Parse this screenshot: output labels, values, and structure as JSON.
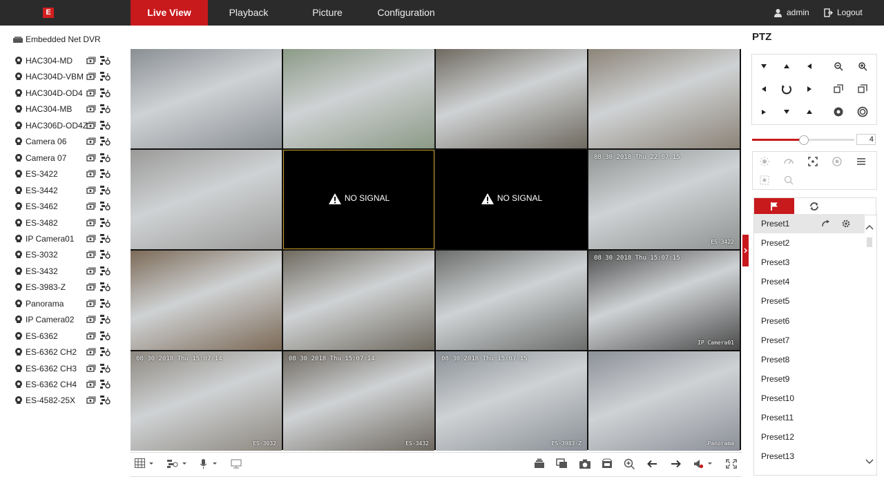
{
  "logo": {
    "text": "E"
  },
  "nav": [
    "Live View",
    "Playback",
    "Picture",
    "Configuration"
  ],
  "user": {
    "name": "admin",
    "logout": "Logout"
  },
  "tree": {
    "root": "Embedded Net DVR",
    "cameras": [
      "HAC304-MD",
      "HAC304D-VBM",
      "HAC304D-OD4",
      "HAC304-MB",
      "HAC306D-OD4Z",
      "Camera 06",
      "Camera 07",
      "ES-3422",
      "ES-3442",
      "ES-3462",
      "ES-3482",
      "IP Camera01",
      "ES-3032",
      "ES-3432",
      "ES-3983-Z",
      "Panorama",
      "IP Camera02",
      "ES-6362",
      "ES-6362 CH2",
      "ES-6362 CH3",
      "ES-6362 CH4",
      "ES-4582-25X"
    ]
  },
  "tiles": [
    {
      "osd": "",
      "name": "",
      "bg": "#8a8f94"
    },
    {
      "osd": "",
      "name": "",
      "bg": "#8b9a86"
    },
    {
      "osd": "",
      "name": "",
      "bg": "#6f6a60"
    },
    {
      "osd": "",
      "name": "",
      "bg": "#8c8478"
    },
    {
      "osd": "",
      "name": "",
      "bg": "#9a9a98"
    },
    {
      "osd": "",
      "name": "",
      "bg": "#000000",
      "nosignal": "NO SIGNAL",
      "selected": true
    },
    {
      "osd": "",
      "name": "",
      "bg": "#000000",
      "nosignal": "NO SIGNAL"
    },
    {
      "osd": "08 30 2018 Thu 22:07:15",
      "name": "ES-3422",
      "bg": "#8f9392"
    },
    {
      "osd": "",
      "name": "",
      "bg": "#7c6a57"
    },
    {
      "osd": "",
      "name": "",
      "bg": "#6f6a5f"
    },
    {
      "osd": "",
      "name": "",
      "bg": "#6c6e6c"
    },
    {
      "osd": "08 30 2018 Thu 15:07:15",
      "name": "IP Camera01",
      "bg": "#4a4a4a"
    },
    {
      "osd": "08 30 2018 Thu 15:07:14",
      "name": "ES-3032",
      "bg": "#8d8880"
    },
    {
      "osd": "08 30 2018 Thu 15:07:14",
      "name": "ES-3432",
      "bg": "#6e6860"
    },
    {
      "osd": "08 30 2018 Thu 15:07:15",
      "name": "ES-3983-Z",
      "bg": "#8a9096"
    },
    {
      "osd": "",
      "name": "Panorama",
      "bg": "#8c9098"
    }
  ],
  "ptz": {
    "title": "PTZ",
    "speed": "4",
    "speed_fraction": 0.5,
    "tabs": {
      "active_color": "#c8191c"
    },
    "presets": [
      "Preset1",
      "Preset2",
      "Preset3",
      "Preset4",
      "Preset5",
      "Preset6",
      "Preset7",
      "Preset8",
      "Preset9",
      "Preset10",
      "Preset11",
      "Preset12",
      "Preset13"
    ]
  },
  "colors": {
    "accent": "#c8191c",
    "topbar": "#2b2b2b"
  }
}
